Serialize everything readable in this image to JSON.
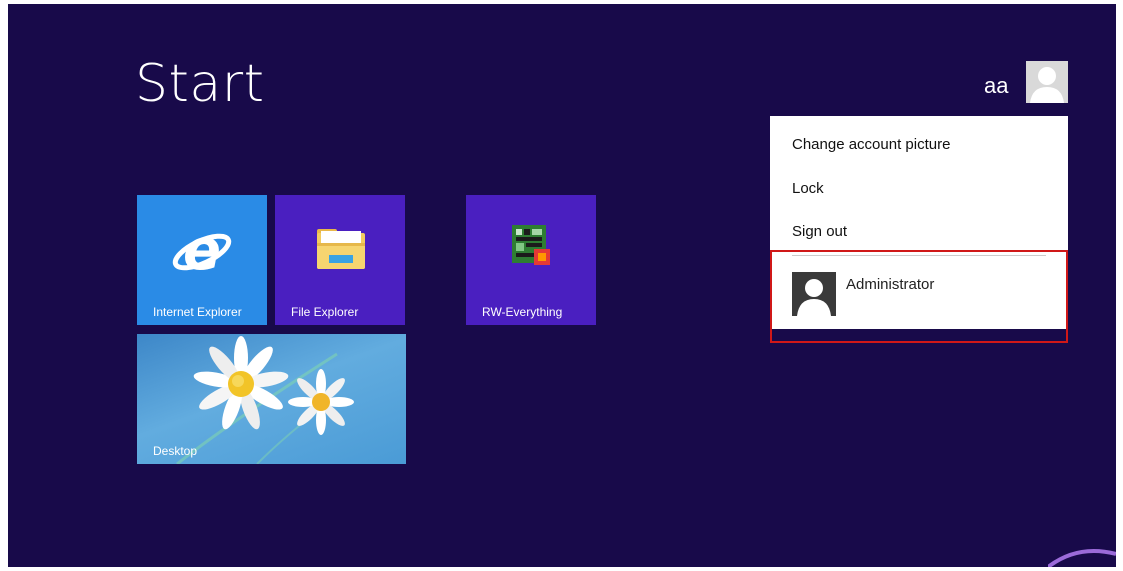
{
  "start": {
    "title": "Start"
  },
  "tiles": {
    "internet_explorer": {
      "label": "Internet Explorer",
      "icon": "internet-explorer-icon",
      "color": "#2a8be6"
    },
    "file_explorer": {
      "label": "File Explorer",
      "icon": "folder-icon",
      "color": "#4a1fc0"
    },
    "rw_everything": {
      "label": "RW-Everything",
      "icon": "rw-everything-icon",
      "color": "#4a1fc0"
    },
    "desktop": {
      "label": "Desktop",
      "icon": "daisy-wallpaper"
    }
  },
  "user": {
    "name": "aa",
    "icon": "user-avatar-icon"
  },
  "account_menu": {
    "change_picture": "Change account picture",
    "lock": "Lock",
    "sign_out": "Sign out",
    "other_account": {
      "name": "Administrator",
      "icon": "user-avatar-icon"
    }
  },
  "colors": {
    "background": "#180a4a",
    "highlight": "#d01818"
  }
}
